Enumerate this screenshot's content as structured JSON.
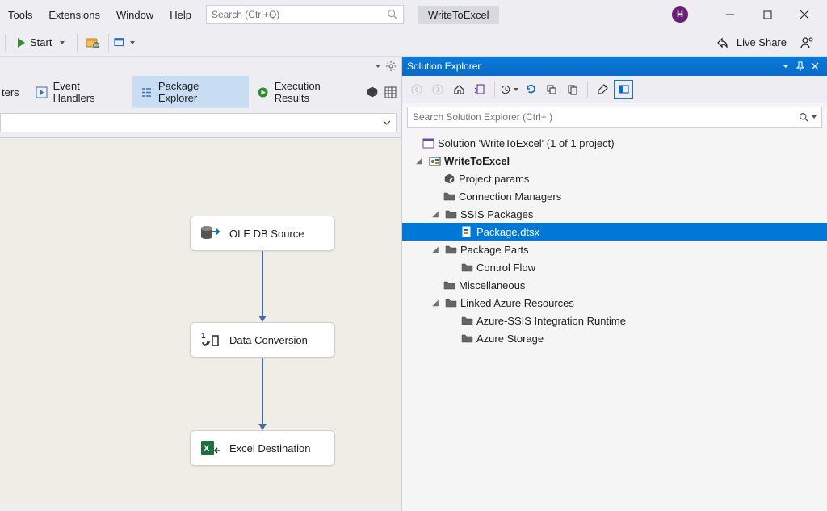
{
  "menubar": {
    "items": [
      "Tools",
      "Extensions",
      "Window",
      "Help"
    ]
  },
  "search_top": {
    "placeholder": "Search (Ctrl+Q)"
  },
  "project_title": "WriteToExcel",
  "avatar_initial": "H",
  "toolbar": {
    "start_label": "Start",
    "live_share_label": "Live Share"
  },
  "tabs": {
    "items": [
      {
        "label": "ters"
      },
      {
        "label": "Event Handlers"
      },
      {
        "label": "Package Explorer",
        "active": true
      },
      {
        "label": "Execution Results"
      }
    ]
  },
  "flow": {
    "nodes": [
      {
        "label": "OLE DB Source"
      },
      {
        "label": "Data Conversion"
      },
      {
        "label": "Excel Destination"
      }
    ]
  },
  "solution_explorer": {
    "title": "Solution Explorer",
    "search_placeholder": "Search Solution Explorer (Ctrl+;)",
    "root": "Solution 'WriteToExcel' (1 of 1 project)",
    "project": "WriteToExcel",
    "nodes": {
      "project_params": "Project.params",
      "connection_managers": "Connection Managers",
      "ssis_packages": "SSIS Packages",
      "package_dtsx": "Package.dtsx",
      "package_parts": "Package Parts",
      "control_flow": "Control Flow",
      "miscellaneous": "Miscellaneous",
      "linked_azure": "Linked Azure Resources",
      "azure_ssis_ir": "Azure-SSIS Integration Runtime",
      "azure_storage": "Azure Storage"
    }
  }
}
